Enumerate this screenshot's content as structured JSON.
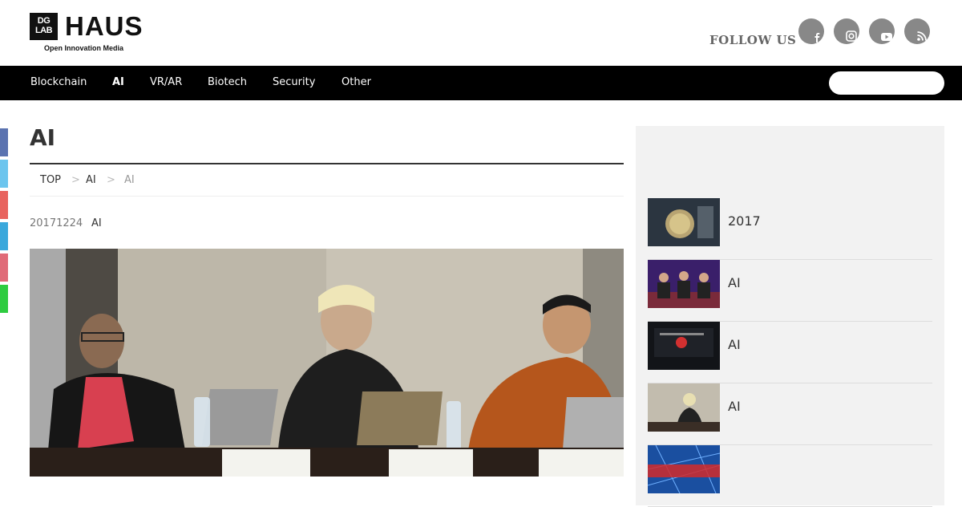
{
  "brand": {
    "logo_box": "DG\nLAB",
    "logo_word": "HAUS",
    "tagline": "Open Innovation Media"
  },
  "header": {
    "follow_label": "FOLLOW US",
    "social_icons": [
      "facebook-icon",
      "instagram-icon",
      "youtube-icon",
      "rss-icon"
    ]
  },
  "nav": {
    "items": [
      {
        "label": "Blockchain"
      },
      {
        "label": "AI",
        "active": true
      },
      {
        "label": "VR/AR"
      },
      {
        "label": "Biotech"
      },
      {
        "label": "Security"
      },
      {
        "label": "Other"
      }
    ],
    "search_placeholder": ""
  },
  "share_colors": [
    "#5b73b0",
    "#6cc5ee",
    "#e8635e",
    "#3aa8dc",
    "#e06b78",
    "#2ecc40"
  ],
  "page": {
    "title": "AI",
    "breadcrumb": {
      "top": "TOP",
      "sep1": ">",
      "cat": "AI",
      "sep2": ">",
      "current": "AI"
    },
    "date": "20171224",
    "category": "AI"
  },
  "sidebar": {
    "items": [
      {
        "title": "2017"
      },
      {
        "title": "AI"
      },
      {
        "title": "AI"
      },
      {
        "title": "AI"
      },
      {
        "title": ""
      }
    ]
  },
  "colors": {
    "nav_bg": "#000000",
    "sidebar_bg": "#f2f2f2",
    "accent": "#333333"
  }
}
